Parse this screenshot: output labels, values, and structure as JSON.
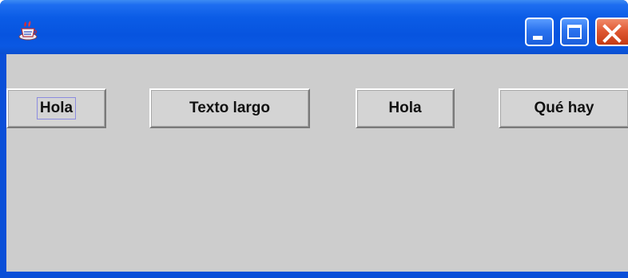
{
  "window": {
    "title": "",
    "app_icon": "java-cup-icon",
    "controls": {
      "minimize_icon": "minimize-icon",
      "maximize_icon": "maximize-icon",
      "close_icon": "close-icon"
    },
    "colors": {
      "titlebar": "#0a58e3",
      "content_background": "#cdcdcd",
      "close_button": "#e05a34"
    }
  },
  "buttons": [
    {
      "label": "Hola",
      "focused": true
    },
    {
      "label": "Texto largo",
      "focused": false
    },
    {
      "label": "Hola",
      "focused": false
    },
    {
      "label": "Qué hay",
      "focused": false
    }
  ]
}
